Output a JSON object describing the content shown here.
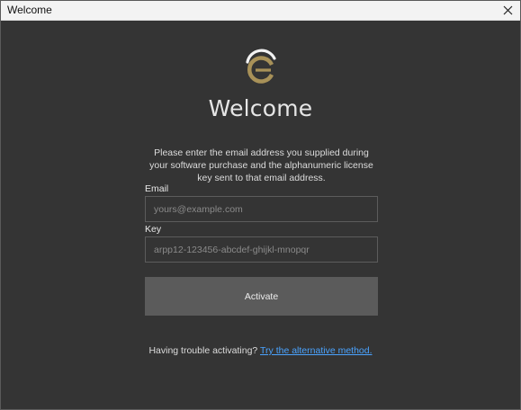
{
  "window": {
    "title": "Welcome"
  },
  "icons": {
    "close": "close-icon",
    "logo": "c-logo"
  },
  "colors": {
    "logo_gold": "#a89158",
    "logo_white": "#f2f2f2",
    "link": "#4aa3ff",
    "background": "#343434",
    "button": "#5b5b5b"
  },
  "main": {
    "heading": "Welcome",
    "instructions": "Please enter the email address you supplied during your software purchase and the alphanumeric license key sent to that email address.",
    "email_label": "Email",
    "email_placeholder": "yours@example.com",
    "email_value": "",
    "key_label": "Key",
    "key_placeholder": "arpp12-123456-abcdef-ghijkl-mnopqr",
    "key_value": "",
    "activate_label": "Activate",
    "trouble_text": "Having trouble activating?",
    "alt_link_text": "Try the alternative method."
  }
}
